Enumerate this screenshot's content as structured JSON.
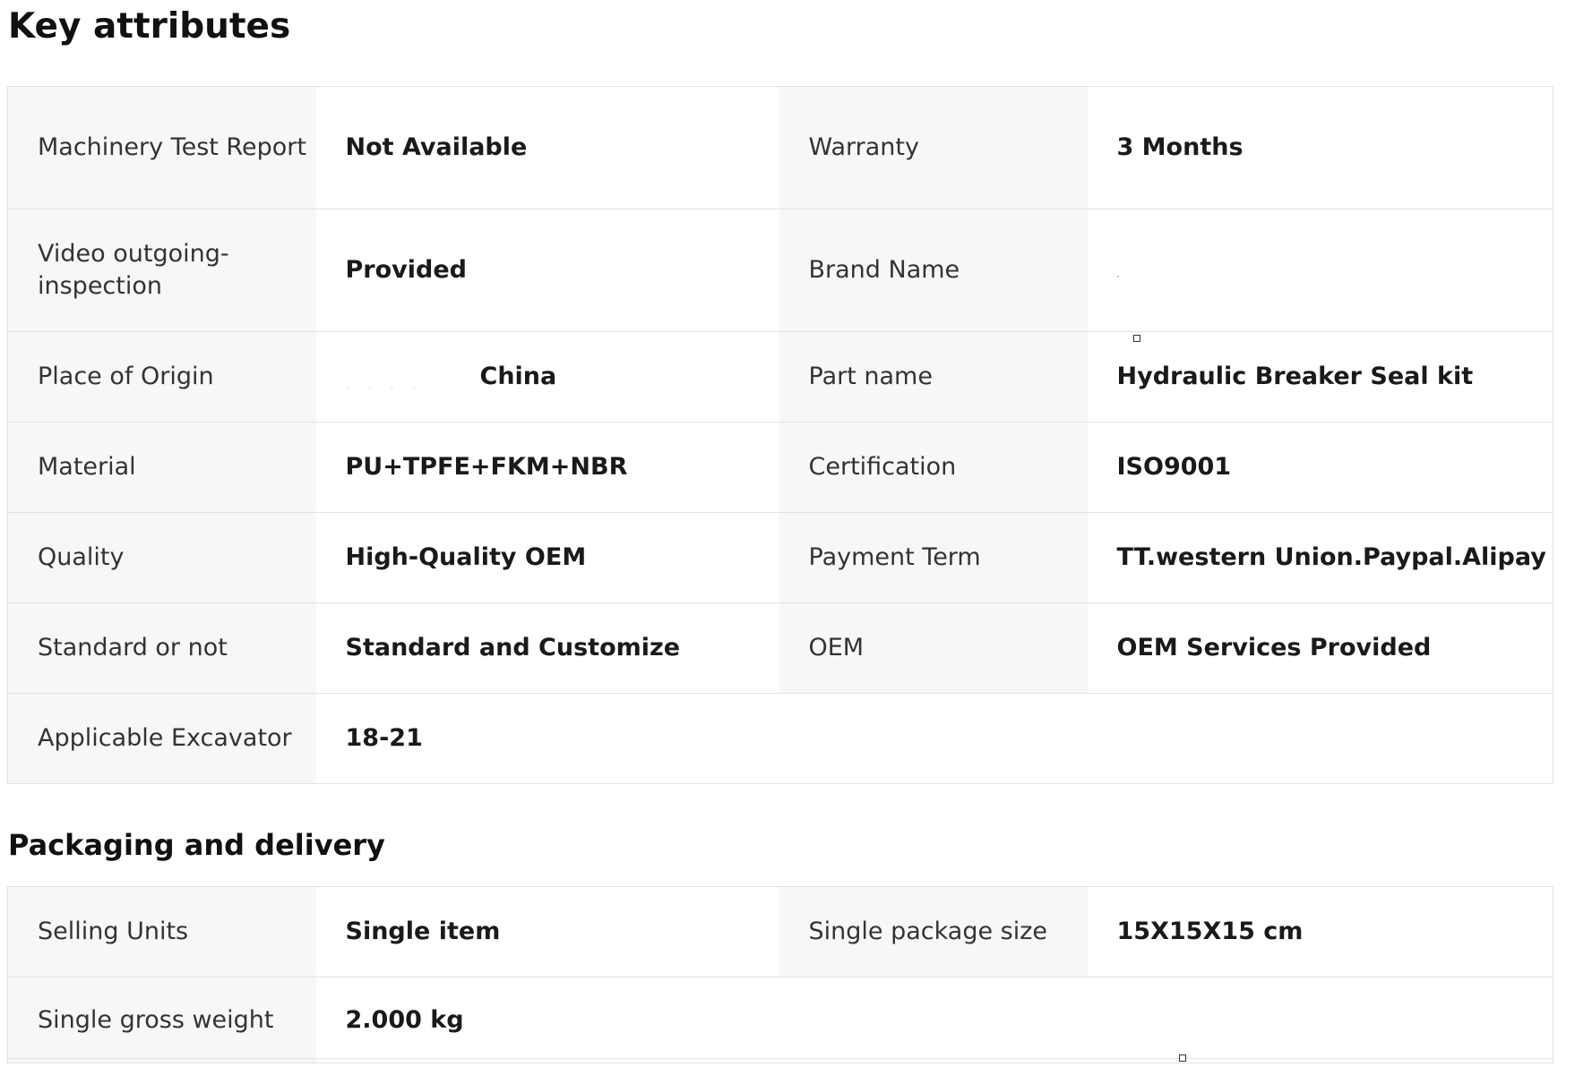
{
  "key_attributes": {
    "title": "Key attributes",
    "rows": [
      {
        "l1": "Machinery Test Report",
        "v1": "Not Available",
        "l2": "Warranty",
        "v2": "3 Months"
      },
      {
        "l1": "Video outgoing-inspection",
        "v1": "Provided",
        "l2": "Brand Name",
        "v2": ""
      },
      {
        "l1": "Place of Origin",
        "v1": "China",
        "l2": "Part name",
        "v2": "Hydraulic Breaker Seal kit"
      },
      {
        "l1": "Material",
        "v1": "PU+TPFE+FKM+NBR",
        "l2": "Certification",
        "v2": "ISO9001"
      },
      {
        "l1": "Quality",
        "v1": "High-Quality OEM",
        "l2": "Payment Term",
        "v2": "TT.western Union.Paypal.Alipay"
      },
      {
        "l1": "Standard or not",
        "v1": "Standard and Customize",
        "l2": "OEM",
        "v2": "OEM Services Provided"
      },
      {
        "l1": "Applicable Excavator",
        "v1": "18-21"
      }
    ]
  },
  "packaging": {
    "title": "Packaging and delivery",
    "rows": [
      {
        "l1": "Selling Units",
        "v1": "Single item",
        "l2": "Single package size",
        "v2": "15X15X15 cm"
      },
      {
        "l1": "Single gross weight",
        "v1": "2.000 kg"
      }
    ]
  }
}
